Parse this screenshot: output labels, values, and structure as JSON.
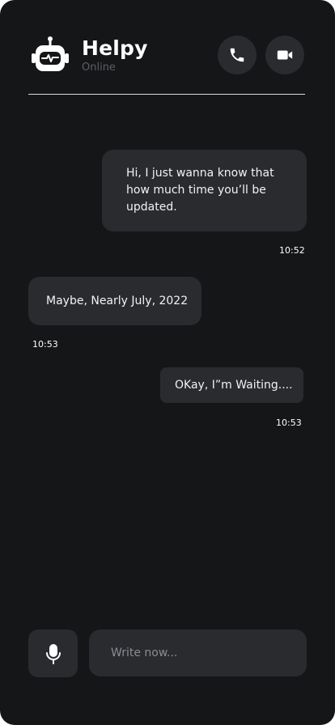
{
  "header": {
    "title": "Helpy",
    "status": "Online",
    "avatar_icon": "robot-icon",
    "call_icon": "phone-icon",
    "video_icon": "video-camera-icon"
  },
  "messages": [
    {
      "sender": "user",
      "text": "Hi, I just wanna know that how much time you’ll be updated.",
      "time": "10:52"
    },
    {
      "sender": "bot",
      "text": "Maybe, Nearly July, 2022",
      "time": "10:53"
    },
    {
      "sender": "user",
      "text": "OKay, I”m Waiting....",
      "time": "10:53"
    }
  ],
  "composer": {
    "mic_icon": "microphone-icon",
    "placeholder": "Write now..."
  },
  "colors": {
    "background": "#141618",
    "surface": "#2a2b2f",
    "text": "#ffffff",
    "muted": "#5b5e63"
  }
}
